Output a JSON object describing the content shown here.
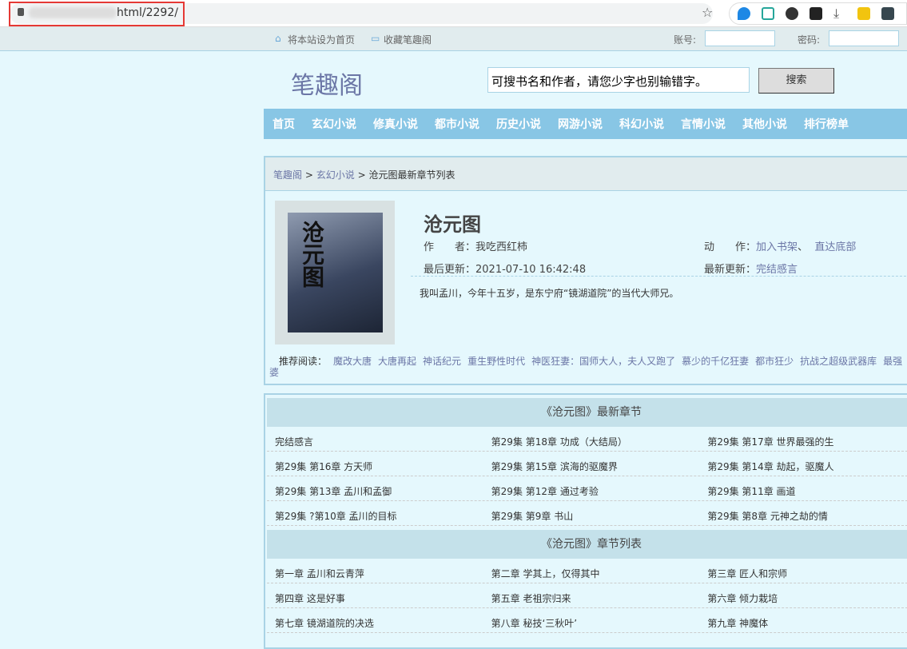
{
  "browser": {
    "url": "html/2292/"
  },
  "topbar": {
    "set_home": "将本站设为首页",
    "bookmark": "收藏笔趣阁",
    "account_label": "账号:",
    "password_label": "密码:"
  },
  "header": {
    "logo": "笔趣阁",
    "search_value": "可搜书名和作者，请您少字也别输错字。",
    "search_button": "搜索"
  },
  "nav": [
    "首页",
    "玄幻小说",
    "修真小说",
    "都市小说",
    "历史小说",
    "网游小说",
    "科幻小说",
    "言情小说",
    "其他小说",
    "排行榜单"
  ],
  "breadcrumb": {
    "home": "笔趣阁",
    "category": "玄幻小说",
    "current": "沧元图最新章节列表",
    "sep": ">"
  },
  "book": {
    "cover_title": "沧元图",
    "title": "沧元图",
    "author_label": "作　　者：",
    "author": "我吃西红柿",
    "action_label": "动　　作：",
    "add_shelf": "加入书架",
    "sep": "、",
    "to_bottom": "直达底部",
    "updated_label": "最后更新：",
    "updated": "2021-07-10 16:42:48",
    "latest_label": "最新更新：",
    "latest": "完结感言",
    "intro": "我叫孟川，今年十五岁，是东宁府“镜湖道院”的当代大师兄。"
  },
  "recommend": {
    "label": "推荐阅读：",
    "items": [
      "魔改大唐",
      "大唐再起",
      "神话纪元",
      "重生野性时代",
      "神医狂妻：国师大人，夫人又跑了",
      "慕少的千亿狂妻",
      "都市狂少",
      "抗战之超级武器库",
      "最强",
      "婆"
    ]
  },
  "latest_section": {
    "title": "《沧元图》最新章节",
    "rows": [
      [
        "完结感言",
        "第29集 第18章 功成（大结局）",
        "第29集 第17章 世界最强的生"
      ],
      [
        "第29集 第16章 方天师",
        "第29集 第15章 滨海的驱魔界",
        "第29集 第14章 劫起，驱魔人"
      ],
      [
        "第29集 第13章 孟川和孟御",
        "第29集 第12章 通过考验",
        "第29集 第11章 画道"
      ],
      [
        "第29集 ?第10章 孟川的目标",
        "第29集 第9章 书山",
        "第29集 第8章 元神之劫的情"
      ]
    ]
  },
  "list_section": {
    "title": "《沧元图》章节列表",
    "rows": [
      [
        "第一章 孟川和云青萍",
        "第二章 学其上，仅得其中",
        "第三章 匠人和宗师"
      ],
      [
        "第四章 这是好事",
        "第五章 老祖宗归来",
        "第六章 倾力栽培"
      ],
      [
        "第七章 镜湖道院的决选",
        "第八章 秘技‘三秋叶’",
        "第九章 神魔体"
      ]
    ]
  }
}
